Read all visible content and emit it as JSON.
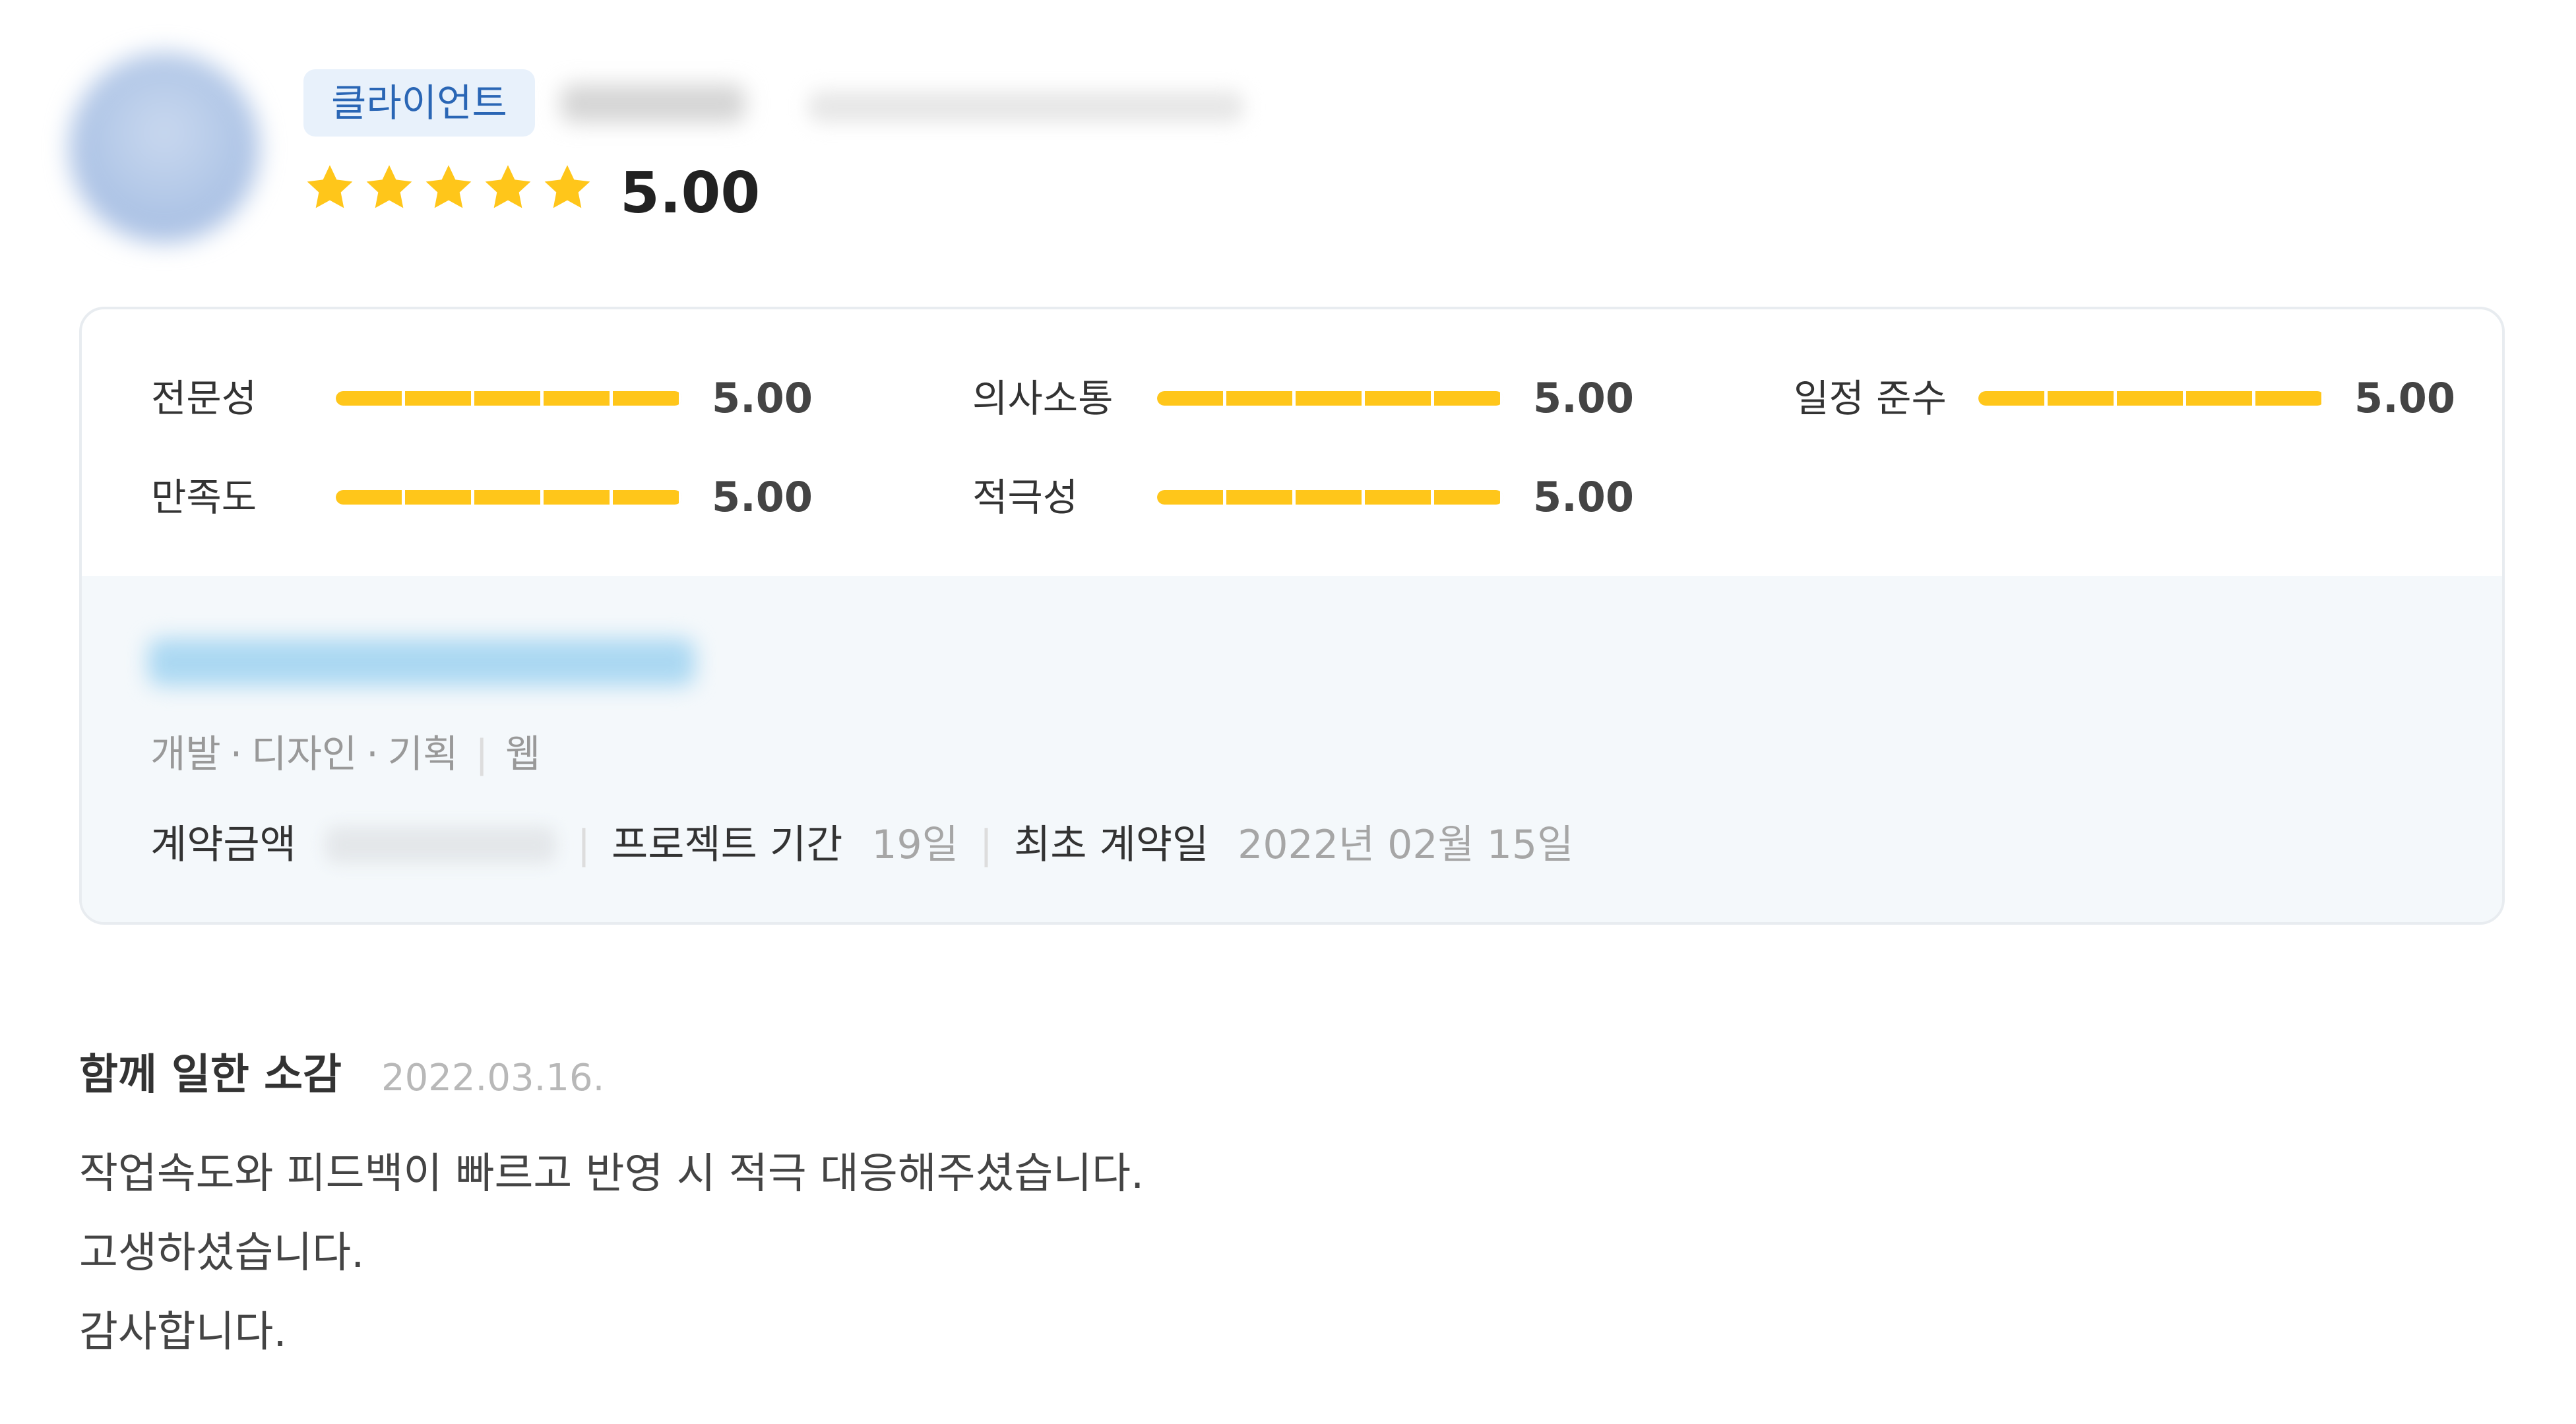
{
  "header": {
    "badge_label": "클라이언트",
    "star_rating": 5,
    "star_max": 5,
    "overall_score": "5.00"
  },
  "ratings": [
    {
      "label": "전문성",
      "value": "5.00",
      "fill": 1.0
    },
    {
      "label": "의사소통",
      "value": "5.00",
      "fill": 1.0
    },
    {
      "label": "일정 준수",
      "value": "5.00",
      "fill": 1.0
    },
    {
      "label": "만족도",
      "value": "5.00",
      "fill": 1.0
    },
    {
      "label": "적극성",
      "value": "5.00",
      "fill": 1.0
    }
  ],
  "project": {
    "categories": [
      "개발",
      "디자인",
      "기획"
    ],
    "category_dot": "·",
    "separator": "|",
    "platform": "웹",
    "amount_label": "계약금액",
    "duration_label": "프로젝트 기간",
    "duration_value": "19일",
    "first_contract_label": "최초 계약일",
    "first_contract_value": "2022년 02월 15일"
  },
  "review": {
    "title": "함께 일한 소감",
    "date": "2022.03.16.",
    "lines": [
      "작업속도와 피드백이 빠르고 반영 시 적극 대응해주셨습니다.",
      "고생하셨습니다.",
      "감사합니다."
    ]
  },
  "colors": {
    "star": "#ffc61a",
    "bar_fill": "#ffc61a",
    "badge_bg": "#e8f1fb",
    "badge_text": "#2a66b5",
    "info_bg": "#f4f8fb"
  },
  "icons": {
    "star": "star-icon"
  }
}
